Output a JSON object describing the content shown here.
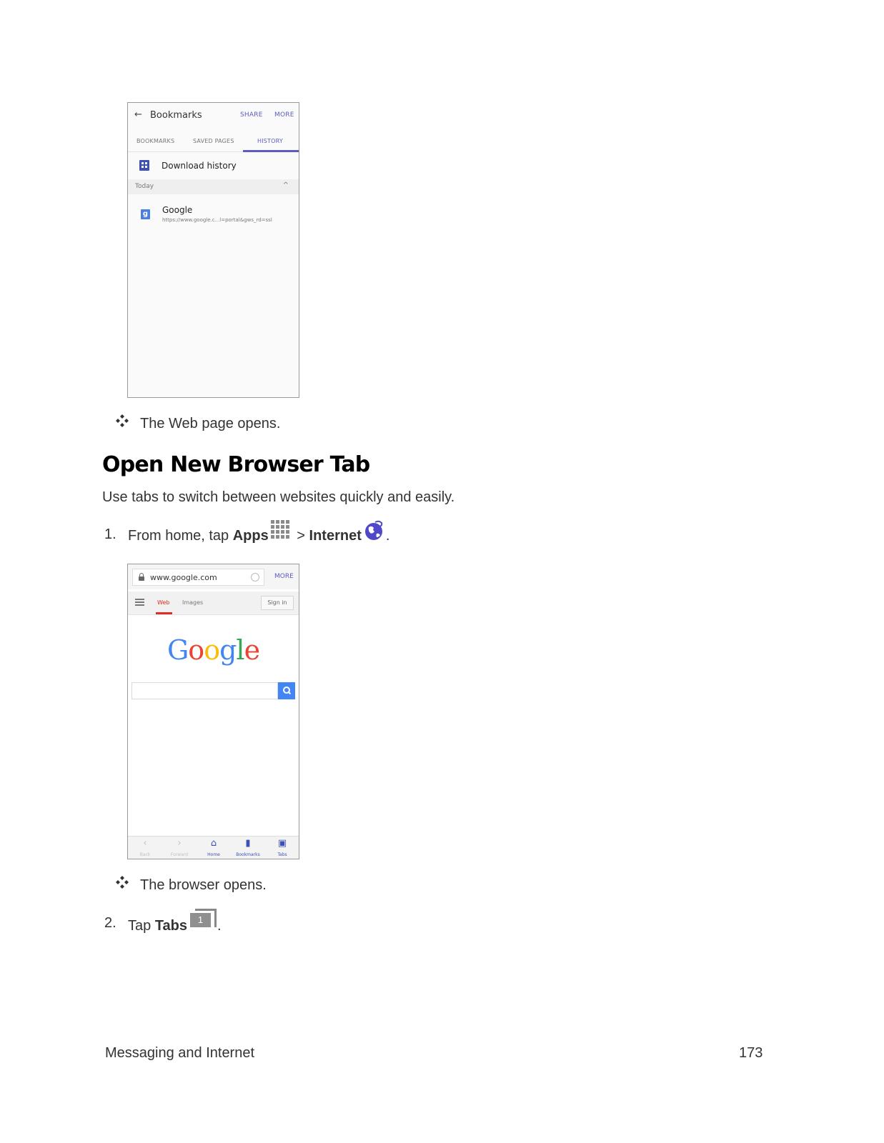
{
  "screenshot1": {
    "back_glyph": "←",
    "title": "Bookmarks",
    "share_label": "SHARE",
    "more_label": "MORE",
    "tabs": [
      "BOOKMARKS",
      "SAVED PAGES",
      "HISTORY"
    ],
    "download_history_label": "Download history",
    "section_label": "Today",
    "caret_glyph": "^",
    "entry_icon_letter": "g",
    "entry_title": "Google",
    "entry_url": "https://www.google.c...l=portal&gws_rd=ssl"
  },
  "bullet1_text": "The Web page opens.",
  "section_heading": "Open New Browser Tab",
  "intro_text": "Use tabs to switch between websites quickly and easily.",
  "step1": {
    "number": "1.",
    "text_before": "From home, tap ",
    "apps_label": "Apps",
    "separator": " > ",
    "internet_label": "Internet",
    "text_after": "."
  },
  "screenshot2": {
    "url_text": "www.google.com",
    "more_label": "MORE",
    "tab_web": "Web",
    "tab_images": "Images",
    "signin_label": "Sign in",
    "logo_letters": [
      "G",
      "o",
      "o",
      "g",
      "l",
      "e"
    ],
    "logo_colors": [
      "#4285f4",
      "#ea4335",
      "#fbbc05",
      "#4285f4",
      "#34a853",
      "#ea4335"
    ],
    "bottom_items": [
      {
        "glyph": "‹",
        "label": "Back"
      },
      {
        "glyph": "›",
        "label": "Forward"
      },
      {
        "glyph": "⌂",
        "label": "Home"
      },
      {
        "glyph": "▮",
        "label": "Bookmarks"
      },
      {
        "glyph": "▣",
        "label": "Tabs"
      }
    ]
  },
  "bullet2_text": "The browser opens.",
  "step2": {
    "number": "2.",
    "text_before": "Tap ",
    "tabs_label": "Tabs",
    "tabs_icon_number": "1",
    "text_after": "."
  },
  "footer": {
    "section": "Messaging and Internet",
    "page_number": "173"
  },
  "colors": {
    "accent_purple": "#5b5bc0",
    "icon_blue": "#3d50b3",
    "google_red": "#d93025",
    "search_blue": "#4285f4"
  }
}
